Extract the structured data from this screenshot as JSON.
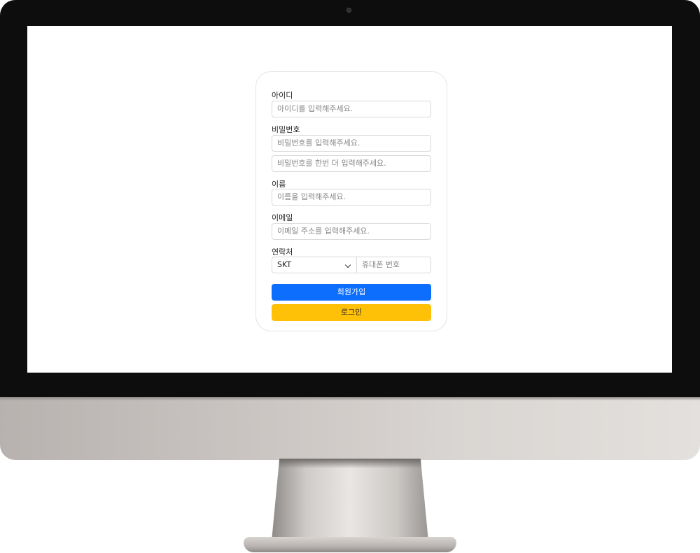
{
  "form": {
    "id_label": "아이디",
    "id_placeholder": "아이디를 입력해주세요.",
    "password_label": "비밀번호",
    "password_placeholder": "비밀번호를 입력해주세요.",
    "password_confirm_placeholder": "비밀번호를 한번 더 입력해주세요.",
    "name_label": "이름",
    "name_placeholder": "이름을 입력해주세요.",
    "email_label": "이메일",
    "email_placeholder": "이메일 주소를 입력해주세요.",
    "contact_label": "연락처",
    "carrier_selected": "SKT",
    "phone_placeholder": "휴대폰 번호",
    "signup_button": "회원가입",
    "login_button": "로그인"
  },
  "colors": {
    "signup": "#0d6efd",
    "login": "#ffc107",
    "bezel": "#0d0d0d"
  },
  "icons": {
    "carrier_dropdown": "chevron-down-icon",
    "camera": "camera-icon"
  }
}
